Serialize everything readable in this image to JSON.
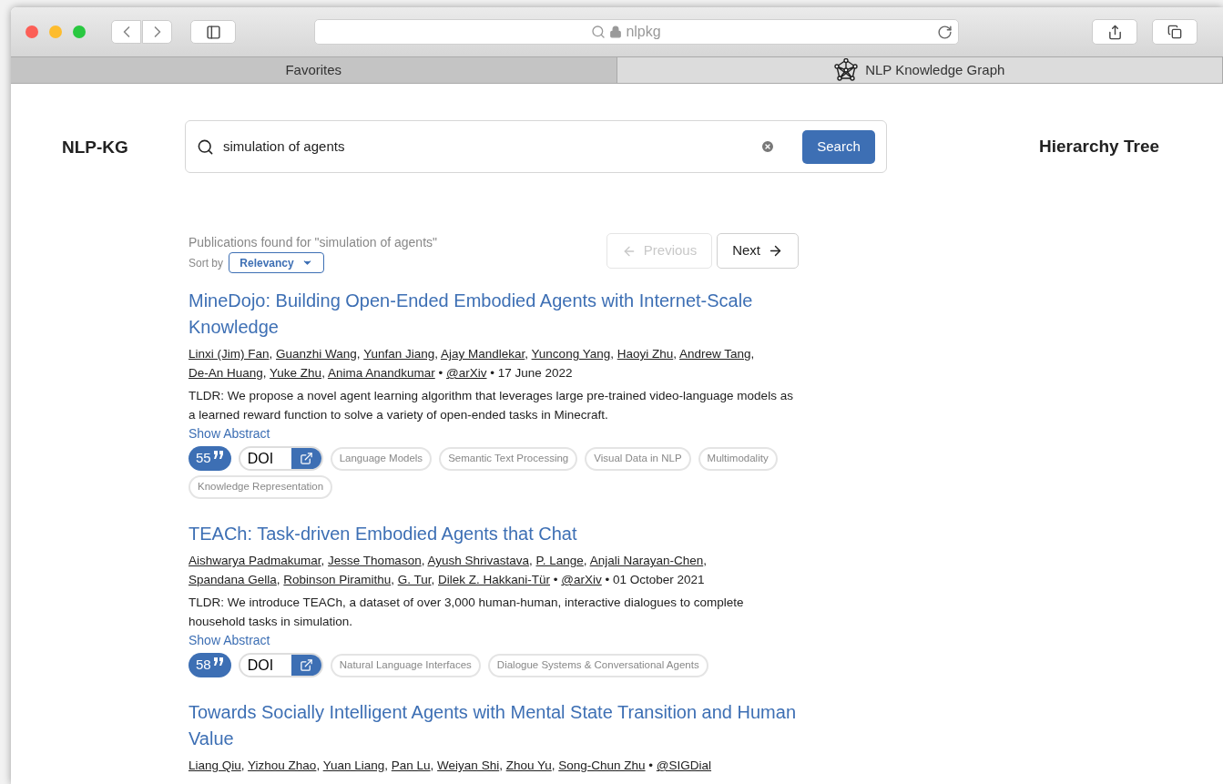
{
  "browser": {
    "address": "nlpkg",
    "tabs": [
      {
        "label": "Favorites",
        "selected": false
      },
      {
        "label": "NLP Knowledge Graph",
        "selected": true
      }
    ]
  },
  "header": {
    "logo": "NLP-KG",
    "search": {
      "value": "simulation of agents",
      "button": "Search"
    },
    "hierarchy_link": "Hierarchy Tree"
  },
  "results": {
    "summary": "Publications found for \"simulation of agents\"",
    "sort_label": "Sort by",
    "sort_value": "Relevancy",
    "previous": {
      "label": "Previous",
      "disabled": true
    },
    "next": {
      "label": "Next",
      "disabled": false
    },
    "items": [
      {
        "title": "MineDojo: Building Open-Ended Embodied Agents with Internet-Scale Knowledge",
        "authors": [
          "Linxi (Jim) Fan",
          "Guanzhi Wang",
          "Yunfan Jiang",
          "Ajay Mandlekar",
          "Yuncong Yang",
          "Haoyi Zhu",
          "Andrew Tang",
          "De-An Huang",
          "Yuke Zhu",
          "Anima Anandkumar"
        ],
        "separator": ",",
        "bullet": "•",
        "venue": "@arXiv",
        "date": "17 June 2022",
        "tldr": "TLDR: We propose a novel agent learning algorithm that leverages large pre-trained video-language models as a learned reward function to solve a variety of open-ended tasks in Minecraft.",
        "show_abstract": "Show Abstract",
        "citations": "55",
        "doi": "DOI",
        "tags": [
          "Language Models",
          "Semantic Text Processing",
          "Visual Data in NLP",
          "Multimodality",
          "Knowledge Representation"
        ]
      },
      {
        "title": "TEACh: Task-driven Embodied Agents that Chat",
        "authors": [
          "Aishwarya Padmakumar",
          "Jesse Thomason",
          "Ayush Shrivastava",
          "P. Lange",
          "Anjali Narayan-Chen",
          "Spandana Gella",
          "Robinson Piramithu",
          "G. Tur",
          "Dilek Z. Hakkani-Tür"
        ],
        "separator": ",",
        "bullet": "•",
        "venue": "@arXiv",
        "date": "01 October 2021",
        "tldr": "TLDR: We introduce TEACh, a dataset of over 3,000 human-human, interactive dialogues to complete household tasks in simulation.",
        "show_abstract": "Show Abstract",
        "citations": "58",
        "doi": "DOI",
        "tags": [
          "Natural Language Interfaces",
          "Dialogue Systems & Conversational Agents"
        ]
      },
      {
        "title": "Towards Socially Intelligent Agents with Mental State Transition and Human Value",
        "authors": [
          "Liang Qiu",
          "Yizhou Zhao",
          "Yuan Liang",
          "Pan Lu",
          "Weiyan Shi",
          "Zhou Yu",
          "Song-Chun Zhu"
        ],
        "separator": ",",
        "bullet": "•",
        "venue": "@SIGDial"
      }
    ]
  }
}
